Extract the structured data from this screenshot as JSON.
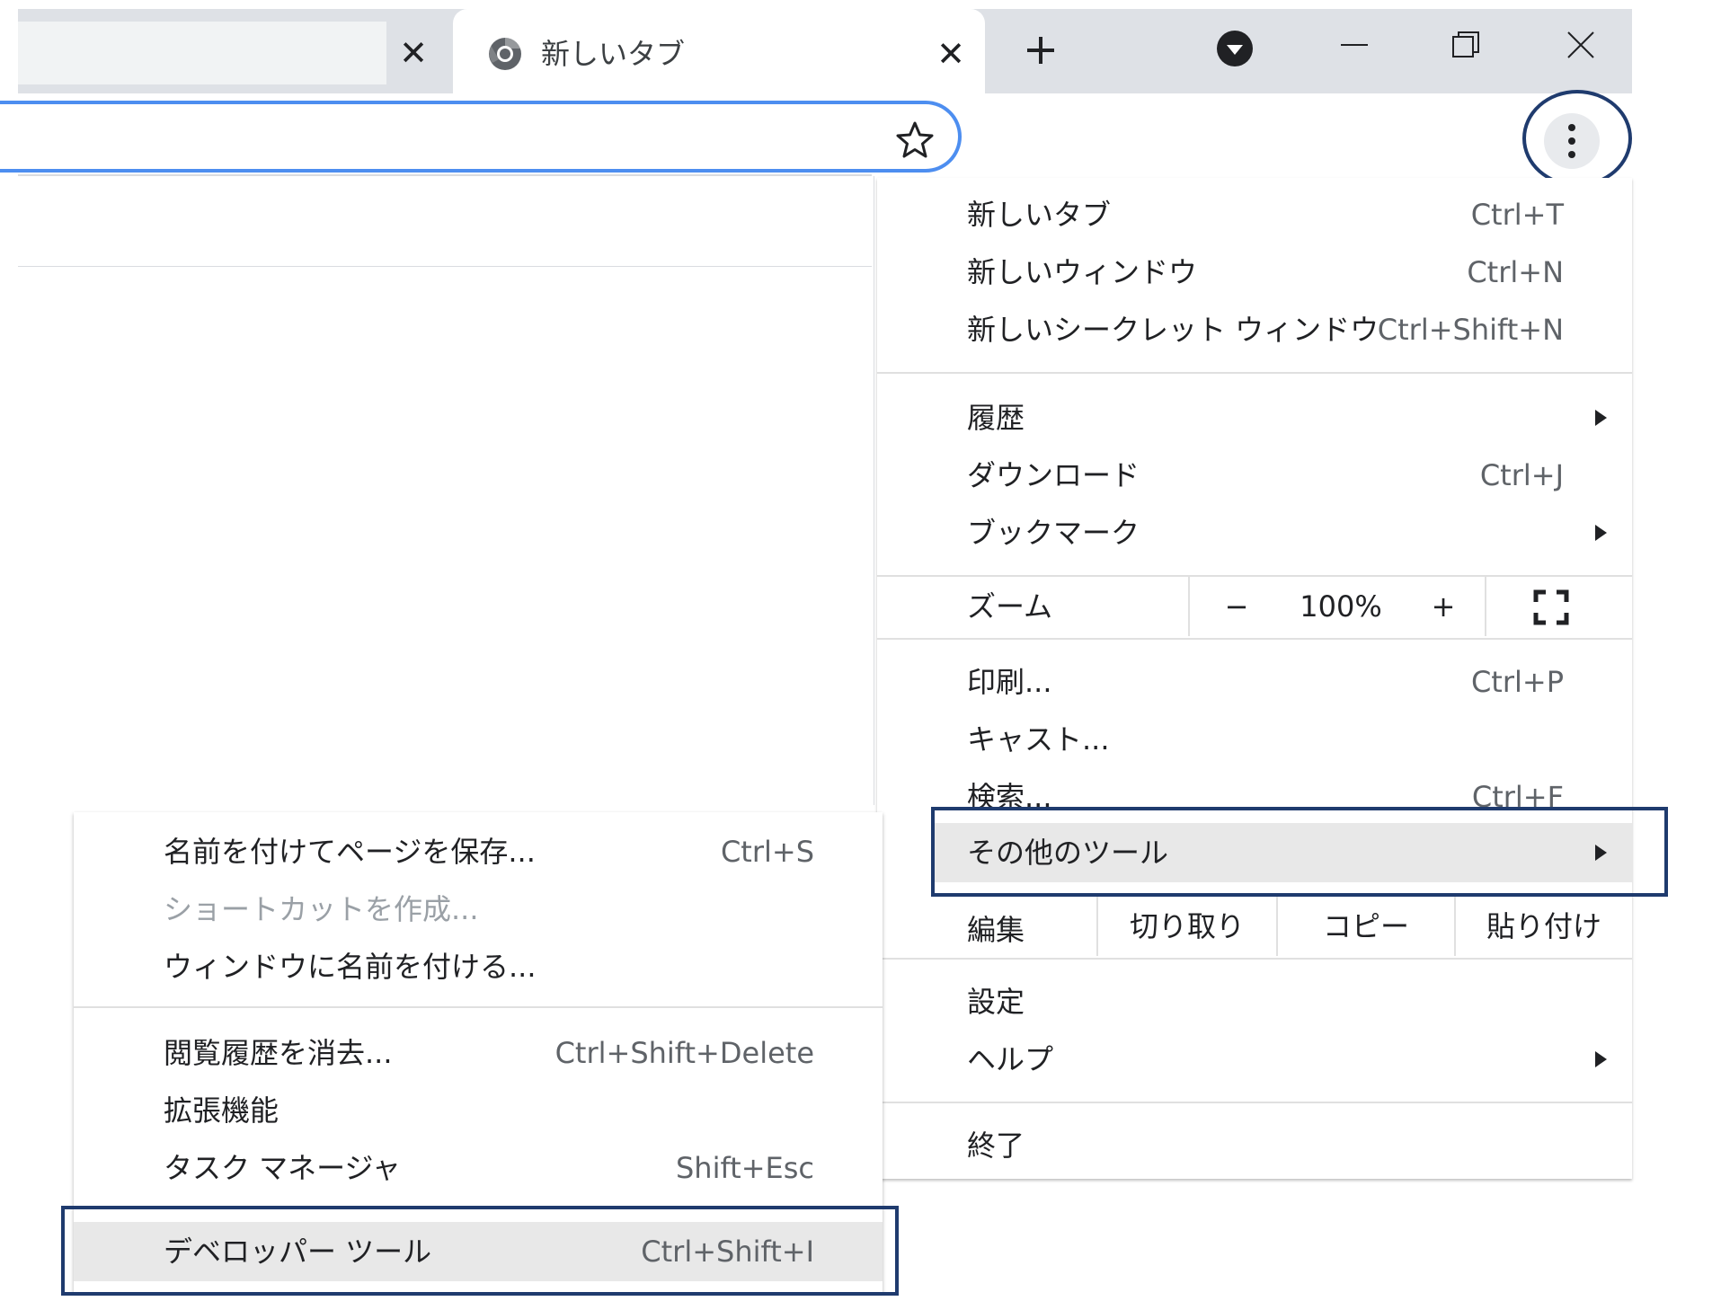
{
  "tabs": {
    "active_title": "新しいタブ",
    "close_glyph": "✕",
    "new_tab_glyph": "+"
  },
  "icons": {
    "favicon": "chrome-logo-icon",
    "bookmark": "star-outline-icon",
    "menu": "three-dots-vertical-icon",
    "tab_search": "chevron-down-circle-icon",
    "minimize": "minimize-icon",
    "restore": "restore-icon",
    "close_window": "close-icon",
    "submenu_arrow": "triangle-right-icon",
    "fullscreen": "fullscreen-icon"
  },
  "colors": {
    "highlight_border": "#1f3b6e",
    "omnibox_focus": "#4d8ef0",
    "hover_row": "#e8e8e8",
    "disabled_text": "#9aa0a6"
  },
  "main_menu": {
    "new_tab": {
      "label": "新しいタブ",
      "shortcut": "Ctrl+T"
    },
    "new_window": {
      "label": "新しいウィンドウ",
      "shortcut": "Ctrl+N"
    },
    "incognito": {
      "label": "新しいシークレット ウィンドウ",
      "shortcut": "Ctrl+Shift+N"
    },
    "history": {
      "label": "履歴"
    },
    "downloads": {
      "label": "ダウンロード",
      "shortcut": "Ctrl+J"
    },
    "bookmarks": {
      "label": "ブックマーク"
    },
    "zoom": {
      "label": "ズーム",
      "minus": "−",
      "value": "100%",
      "plus": "+"
    },
    "print": {
      "label": "印刷...",
      "shortcut": "Ctrl+P"
    },
    "cast": {
      "label": "キャスト..."
    },
    "find": {
      "label": "検索...",
      "shortcut": "Ctrl+F"
    },
    "more_tools": {
      "label": "その他のツール"
    },
    "edit": {
      "label": "編集",
      "cut": "切り取り",
      "copy": "コピー",
      "paste": "貼り付け"
    },
    "settings": {
      "label": "設定"
    },
    "help": {
      "label": "ヘルプ"
    },
    "exit": {
      "label": "終了"
    }
  },
  "sub_menu": {
    "save_page": {
      "label": "名前を付けてページを保存...",
      "shortcut": "Ctrl+S"
    },
    "create_shortcut": {
      "label": "ショートカットを作成..."
    },
    "name_window": {
      "label": "ウィンドウに名前を付ける..."
    },
    "clear_data": {
      "label": "閲覧履歴を消去...",
      "shortcut": "Ctrl+Shift+Delete"
    },
    "extensions": {
      "label": "拡張機能"
    },
    "task_manager": {
      "label": "タスク マネージャ",
      "shortcut": "Shift+Esc"
    },
    "dev_tools": {
      "label": "デベロッパー ツール",
      "shortcut": "Ctrl+Shift+I"
    }
  }
}
